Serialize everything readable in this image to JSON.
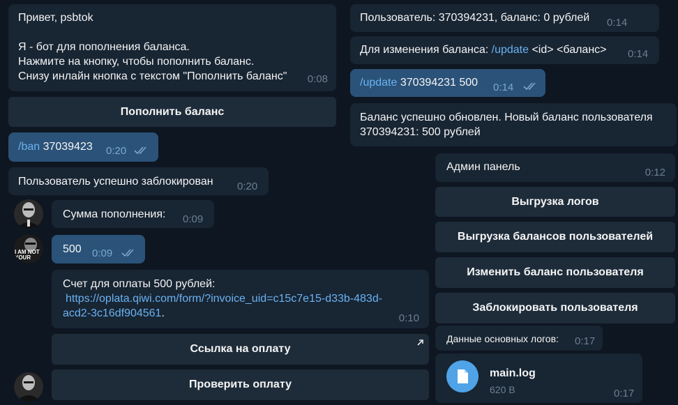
{
  "left": {
    "greeting": {
      "line1": "Привет, psbtok",
      "line2": "Я - бот для пополнения баланса.",
      "line3": "Нажмите на кнопку, чтобы пополнить баланс.",
      "line4": "Снизу инлайн кнопка с текстом \"Пополнить баланс\"",
      "time": "0:08"
    },
    "topup_button": "Пополнить баланс",
    "ban_cmd": {
      "command": "/ban",
      "arg": " 37039423",
      "time": "0:20"
    },
    "blocked": {
      "text": "Пользователь успешно заблокирован",
      "time": "0:20"
    },
    "amount_prompt": {
      "text": "Сумма пополнения:",
      "time": "0:09"
    },
    "amount_reply": {
      "text": "500",
      "time": "0:09"
    },
    "invoice": {
      "line1": "Счет для оплаты 500 рублей:",
      "link_line1": "https://oplata.qiwi.com/form/?invoice_uid=c15c7e15-d33b-483d-",
      "link_line2": "acd2-3c16df904561",
      "period": ".",
      "time": "0:10"
    },
    "pay_link_button": "Ссылка на оплату",
    "check_button": "Проверить оплату"
  },
  "right": {
    "user_info": {
      "text": "Пользователь: 370394231, баланс: 0 рублей",
      "time": "0:14"
    },
    "update_hint": {
      "prefix": "Для изменения баланса: ",
      "command": "/update",
      "suffix": " <id> <баланс>",
      "time": "0:14"
    },
    "update_cmd": {
      "command": "/update",
      "arg": " 370394231 500",
      "time": "0:14"
    },
    "updated": {
      "line1": "Баланс успешно обновлен. Новый баланс пользователя",
      "line2": "370394231: 500 рублей"
    },
    "admin_panel": {
      "text": "Админ панель",
      "time": "0:12"
    },
    "admin_buttons": {
      "logs": "Выгрузка логов",
      "balances": "Выгрузка балансов пользователей",
      "change": "Изменить баланс пользователя",
      "block": "Заблокировать пользователя"
    },
    "logs_caption": {
      "text": "Данные основных логов:",
      "time": "0:17"
    },
    "file": {
      "name": "main.log",
      "size": "620 B",
      "time": "0:17"
    }
  },
  "avatar2_text": {
    "line1": "I AM NOT",
    "line2": "YOUR"
  },
  "colors": {
    "background": "#0e1621",
    "incoming": "#182533",
    "outgoing": "#2b5278",
    "button": "#1e2c3a",
    "link": "#6ab2f2",
    "file_icon": "#4fa3e6"
  },
  "icons": [
    "double-check-icon",
    "external-link-arrow-icon",
    "document-icon",
    "avatar-photo"
  ]
}
